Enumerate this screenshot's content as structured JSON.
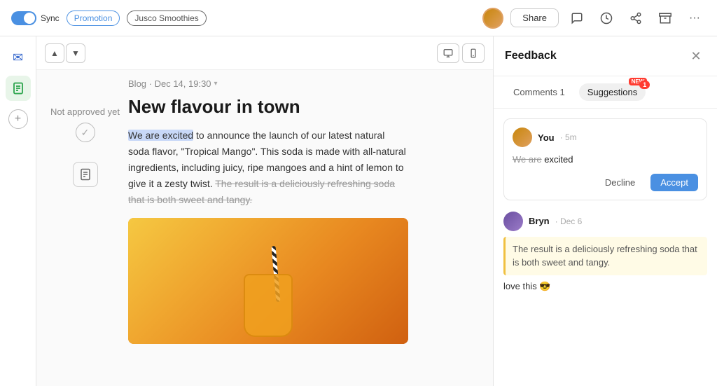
{
  "topbar": {
    "sync_label": "Sync",
    "tag_promotion": "Promotion",
    "tag_jusco": "Jusco Smoothies",
    "share_label": "Share"
  },
  "sidebar": {
    "add_label": "+"
  },
  "content": {
    "meta": "Blog · Dec 14, 19:30",
    "meta_chevron": "▾",
    "title": "New flavour in town",
    "paragraph": " to announce the launch of our latest natural soda flavor, \"Tropical Mango\". This soda is made with all-natural ingredients, including juicy, ripe mangoes and a hint of lemon to give it a zesty twist. ",
    "highlight_text": "We are excited",
    "strikethrough_text": "The result is a deliciously refreshing soda that is both sweet and tangy.",
    "not_approved": "Not approved yet"
  },
  "feedback": {
    "title": "Feedback",
    "tab_comments": "Comments",
    "tab_comments_count": "1",
    "tab_suggestions": "Suggestions",
    "tab_suggestions_badge": "1",
    "tab_suggestions_new": "NEW",
    "suggestion1": {
      "user": "You",
      "time": "5m",
      "deleted_text": "We are",
      "inserted_text": " excited",
      "full_text": "We are excited",
      "decline_label": "Decline",
      "accept_label": "Accept"
    },
    "comment1": {
      "user": "Bryn",
      "time": "Dec 6",
      "quoted": "The result is a deliciously refreshing soda that is both sweet and tangy.",
      "text": "love this 😎"
    }
  }
}
